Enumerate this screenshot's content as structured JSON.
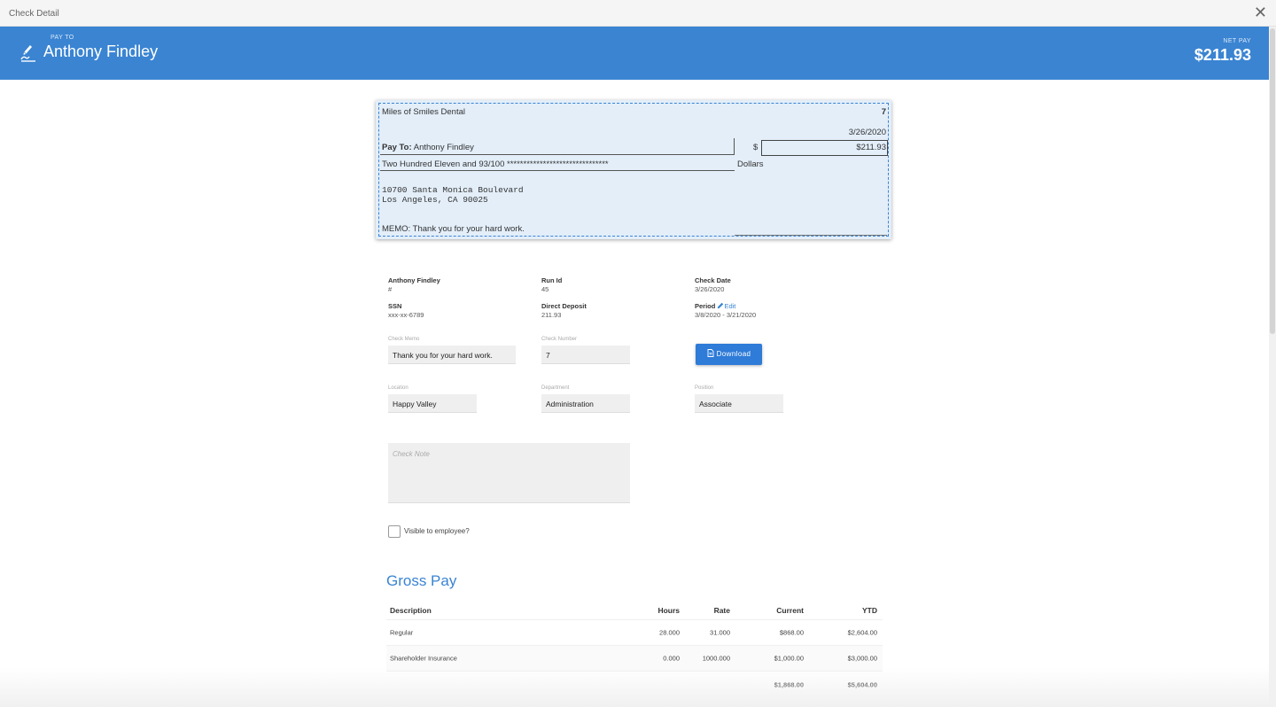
{
  "window": {
    "title": "Check Detail"
  },
  "header": {
    "pay_to_label": "PAY TO",
    "pay_to_name": "Anthony Findley",
    "net_pay_label": "NET PAY",
    "net_pay_value": "$211.93"
  },
  "check": {
    "company": "Miles of Smiles Dental",
    "number": "7",
    "date": "3/26/2020",
    "pay_to_label": "Pay To:",
    "pay_to_name": "Anthony Findley",
    "dollar_sign": "$",
    "amount": "$211.93",
    "amount_words": "Two Hundred Eleven and 93/100 *******************************",
    "dollars_label": "Dollars",
    "address_line1": "10700 Santa Monica Boulevard",
    "address_line2": "Los Angeles, CA 90025",
    "memo": "MEMO: Thank you for your hard work."
  },
  "info": {
    "employee_name": "Anthony Findley",
    "employee_number": "#",
    "run_id_label": "Run Id",
    "run_id": "45",
    "check_date_label": "Check Date",
    "check_date": "3/26/2020",
    "ssn_label": "SSN",
    "ssn": "xxx-xx-6789",
    "direct_deposit_label": "Direct Deposit",
    "direct_deposit": "211.93",
    "period_label": "Period",
    "period_edit": "Edit",
    "period": "3/8/2020 - 3/21/2020"
  },
  "form": {
    "check_memo_label": "Check Memo",
    "check_memo": "Thank you for your hard work.",
    "check_number_label": "Check Number",
    "check_number": "7",
    "download_label": "Download",
    "location_label": "Location",
    "location": "Happy Valley",
    "department_label": "Department",
    "department": "Administration",
    "position_label": "Position",
    "position": "Associate",
    "check_note_placeholder": "Check Note",
    "visible_label": "Visible to employee?"
  },
  "gross_pay": {
    "title": "Gross Pay",
    "columns": {
      "description": "Description",
      "hours": "Hours",
      "rate": "Rate",
      "current": "Current",
      "ytd": "YTD"
    },
    "rows": [
      {
        "description": "Regular",
        "hours": "28.000",
        "rate": "31.000",
        "current": "$868.00",
        "ytd": "$2,604.00"
      },
      {
        "description": "Shareholder Insurance",
        "hours": "0.000",
        "rate": "1000.000",
        "current": "$1,000.00",
        "ytd": "$3,000.00"
      }
    ],
    "totals": {
      "current": "$1,868.00",
      "ytd": "$5,604.00"
    }
  },
  "colors": {
    "primary": "#3a84d2",
    "button": "#2e7bd8",
    "check_bg": "#e3eef9"
  }
}
